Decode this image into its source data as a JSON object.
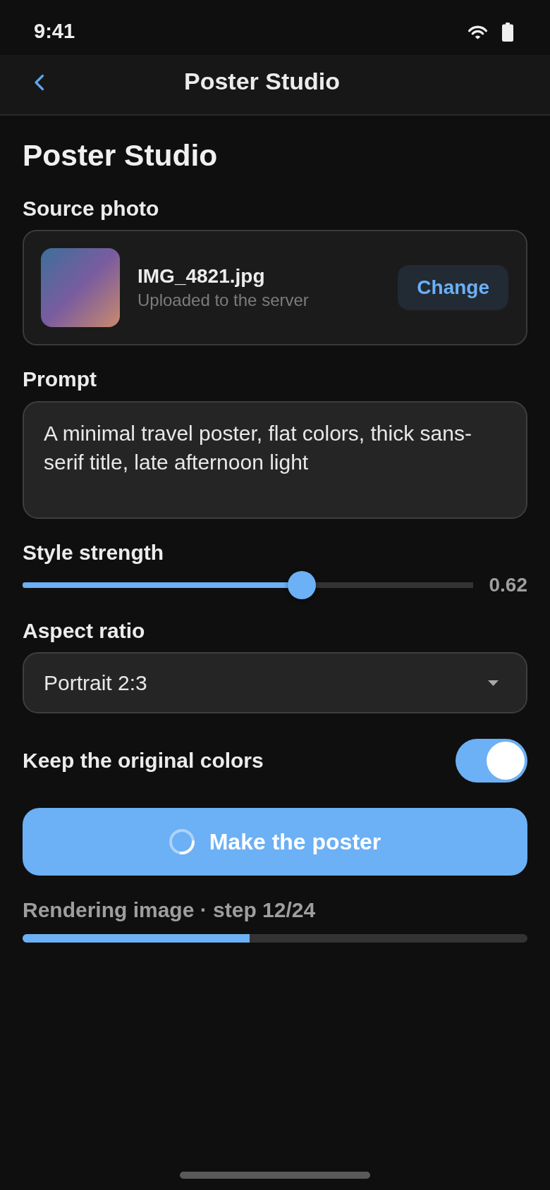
{
  "status_bar": {
    "time": "9:41"
  },
  "nav_bar": {
    "title": "Poster Studio"
  },
  "heading": "Poster Studio",
  "source_photo": {
    "label": "Source photo",
    "file_name": "IMG_4821.jpg",
    "status": "Uploaded to the server",
    "button": "Change"
  },
  "prompt": {
    "label": "Prompt",
    "value": "A minimal travel poster, flat colors, thick sans-serif title, late afternoon light"
  },
  "style_strength": {
    "label": "Style strength",
    "level": 0.62,
    "reading": "0.62"
  },
  "aspect_ratio": {
    "label": "Aspect ratio",
    "value": "Portrait 2:3"
  },
  "keep_colors": {
    "label": "Keep the original colors",
    "on": true
  },
  "generate_button": {
    "label": "Make the poster",
    "busy": true
  },
  "progress": {
    "label": "Rendering image · step 12/24",
    "level": 0.45
  }
}
